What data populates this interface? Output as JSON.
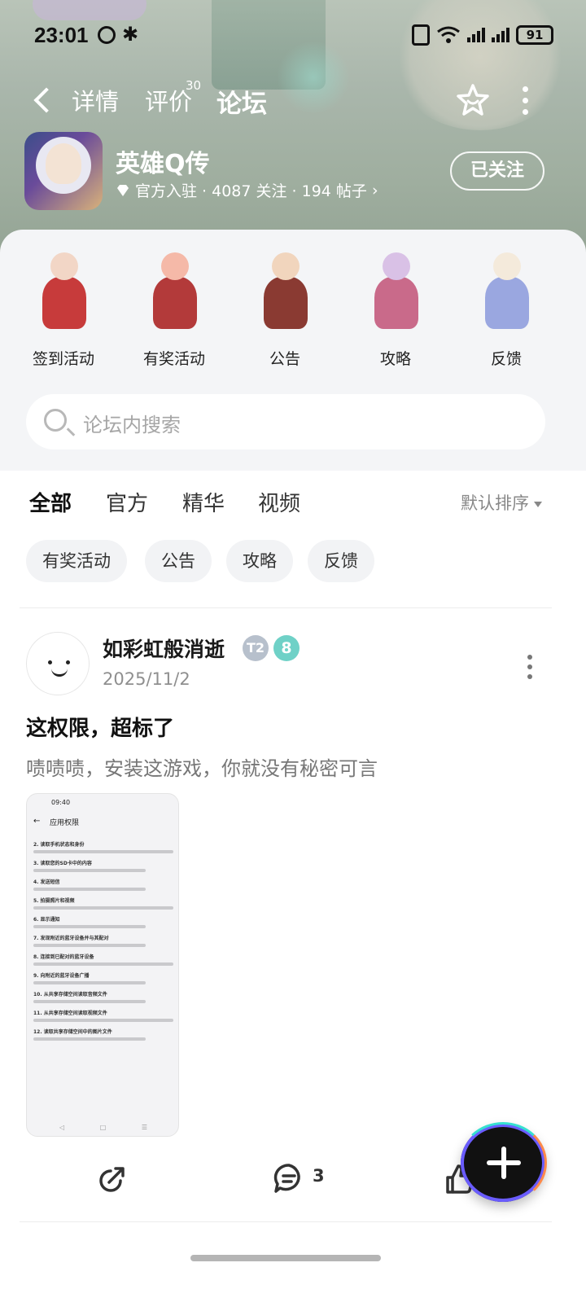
{
  "status": {
    "time": "23:01",
    "battery": "91"
  },
  "nav": {
    "tabs": [
      {
        "label": "详情"
      },
      {
        "label": "评价",
        "badge": "30"
      },
      {
        "label": "论坛"
      }
    ]
  },
  "game": {
    "name": "英雄Q传",
    "meta": "官方入驻 · 4087 关注 · 194 帖子",
    "follow_label": "已关注"
  },
  "categories": [
    {
      "label": "签到活动",
      "colors": [
        "#f2d6c6",
        "#c73b3b"
      ]
    },
    {
      "label": "有奖活动",
      "colors": [
        "#f5b9a8",
        "#b33a3a"
      ]
    },
    {
      "label": "公告",
      "colors": [
        "#f1d5bd",
        "#8a3a32"
      ]
    },
    {
      "label": "攻略",
      "colors": [
        "#d9c1e6",
        "#c96a8a"
      ]
    },
    {
      "label": "反馈",
      "colors": [
        "#f4eadb",
        "#9aa7e0"
      ]
    }
  ],
  "search": {
    "placeholder": "论坛内搜索"
  },
  "filter_tabs": [
    {
      "label": "全部"
    },
    {
      "label": "官方"
    },
    {
      "label": "精华"
    },
    {
      "label": "视频"
    }
  ],
  "sort_label": "默认排序",
  "chips": [
    {
      "label": "有奖活动"
    },
    {
      "label": "公告"
    },
    {
      "label": "攻略"
    },
    {
      "label": "反馈"
    }
  ],
  "post": {
    "author": "如彩虹般消逝",
    "level_badge_1": "T2",
    "level_badge_2": "8",
    "date": "2025/11/2",
    "title": "这权限，超标了",
    "body": "啧啧啧，安装这游戏，你就没有秘密可言",
    "image": {
      "status_time": "09:40",
      "title": "应用权限",
      "items": [
        "2. 读取手机状态和身份",
        "3. 读取您的SD卡中的内容",
        "4. 发送短信",
        "5. 拍摄照片和视频",
        "6. 显示通知",
        "7. 发现附近的蓝牙设备并与其配对",
        "8. 连接到已配对的蓝牙设备",
        "9. 向附近的蓝牙设备广播",
        "10. 从共享存储空间读取音频文件",
        "11. 从共享存储空间读取视频文件",
        "12. 读取共享存储空间中的图片文件"
      ]
    },
    "comment_count": "3"
  },
  "colors": {
    "accent": "#2ee0c0",
    "fab": "#111111"
  }
}
